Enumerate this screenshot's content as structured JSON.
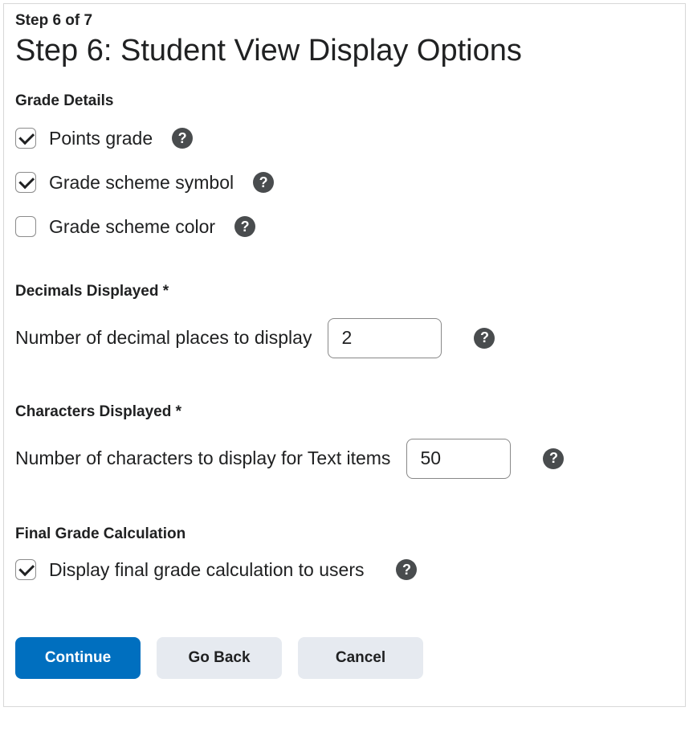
{
  "header": {
    "step_of": "Step 6 of 7",
    "title": "Step 6: Student View Display Options"
  },
  "sections": {
    "grade_details": {
      "heading": "Grade Details",
      "options": [
        {
          "label": "Points grade",
          "checked": true
        },
        {
          "label": "Grade scheme symbol",
          "checked": true
        },
        {
          "label": "Grade scheme color",
          "checked": false
        }
      ]
    },
    "decimals": {
      "heading": "Decimals Displayed *",
      "label": "Number of decimal places to display",
      "value": "2"
    },
    "characters": {
      "heading": "Characters Displayed *",
      "label": "Number of characters to display for Text items",
      "value": "50"
    },
    "final": {
      "heading": "Final Grade Calculation",
      "label": "Display final grade calculation to users",
      "checked": true
    }
  },
  "buttons": {
    "continue": "Continue",
    "back": "Go Back",
    "cancel": "Cancel"
  }
}
